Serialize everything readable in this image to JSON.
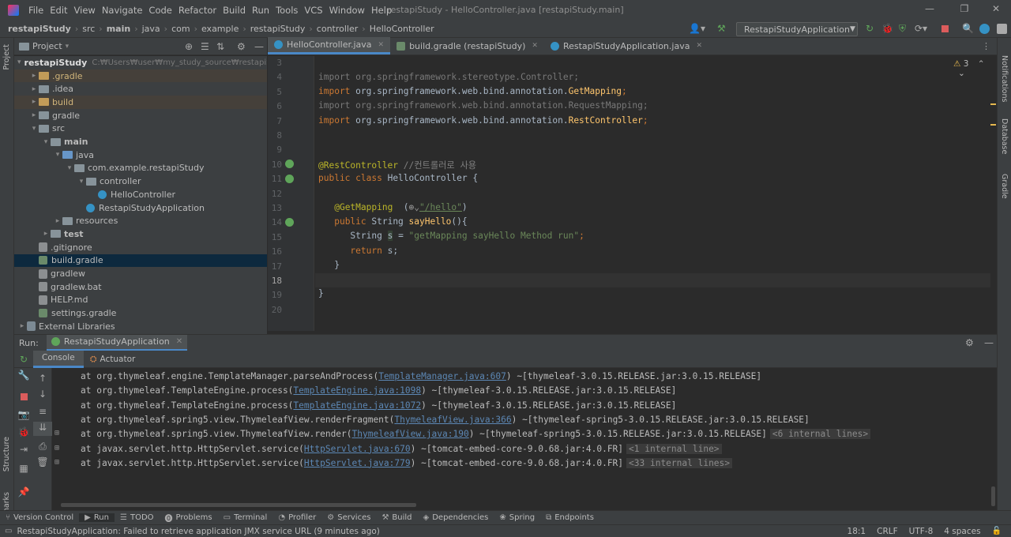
{
  "window": {
    "title": "restapiStudy - HelloController.java [restapiStudy.main]"
  },
  "menu": [
    "File",
    "Edit",
    "View",
    "Navigate",
    "Code",
    "Refactor",
    "Build",
    "Run",
    "Tools",
    "VCS",
    "Window",
    "Help"
  ],
  "breadcrumb": [
    "restapiStudy",
    "src",
    "main",
    "java",
    "com",
    "example",
    "restapiStudy",
    "controller",
    "HelloController"
  ],
  "toolbar": {
    "run_config": "RestapiStudyApplication"
  },
  "project_panel": {
    "title": "Project",
    "root_name": "restapiStudy",
    "root_path": "C:₩Users₩user₩my_study_source₩restapiStudy",
    "items": [
      {
        "label": ".gradle",
        "kind": "folder-orange",
        "depth": 1,
        "arrow": "▸"
      },
      {
        "label": ".idea",
        "kind": "folder",
        "depth": 1,
        "arrow": "▸"
      },
      {
        "label": "build",
        "kind": "folder-orange",
        "depth": 1,
        "arrow": "▸"
      },
      {
        "label": "gradle",
        "kind": "folder",
        "depth": 1,
        "arrow": "▸"
      },
      {
        "label": "src",
        "kind": "folder",
        "depth": 1,
        "arrow": "▾"
      },
      {
        "label": "main",
        "kind": "folder",
        "depth": 2,
        "arrow": "▾"
      },
      {
        "label": "java",
        "kind": "folder-blue",
        "depth": 3,
        "arrow": "▾"
      },
      {
        "label": "com.example.restapiStudy",
        "kind": "folder",
        "depth": 4,
        "arrow": "▾"
      },
      {
        "label": "controller",
        "kind": "folder",
        "depth": 5,
        "arrow": "▾"
      },
      {
        "label": "HelloController",
        "kind": "class",
        "depth": 6,
        "arrow": ""
      },
      {
        "label": "RestapiStudyApplication",
        "kind": "class",
        "depth": 5,
        "arrow": ""
      },
      {
        "label": "resources",
        "kind": "folder",
        "depth": 3,
        "arrow": "▸"
      },
      {
        "label": "test",
        "kind": "folder",
        "depth": 2,
        "arrow": "▸"
      },
      {
        "label": ".gitignore",
        "kind": "file",
        "depth": 1,
        "arrow": ""
      },
      {
        "label": "build.gradle",
        "kind": "gradle",
        "depth": 1,
        "arrow": ""
      },
      {
        "label": "gradlew",
        "kind": "file",
        "depth": 1,
        "arrow": ""
      },
      {
        "label": "gradlew.bat",
        "kind": "file",
        "depth": 1,
        "arrow": ""
      },
      {
        "label": "HELP.md",
        "kind": "file",
        "depth": 1,
        "arrow": ""
      },
      {
        "label": "settings.gradle",
        "kind": "gradle",
        "depth": 1,
        "arrow": ""
      },
      {
        "label": "External Libraries",
        "kind": "lib",
        "depth": 0,
        "arrow": "▸"
      }
    ]
  },
  "editor_tabs": [
    {
      "label": "HelloController.java",
      "icon": "class-icon",
      "active": true
    },
    {
      "label": "build.gradle (restapiStudy)",
      "icon": "gradle-icon",
      "active": false
    },
    {
      "label": "RestapiStudyApplication.java",
      "icon": "class-icon",
      "active": false
    }
  ],
  "inspection": {
    "warnings": "3"
  },
  "code": {
    "line_numbers": [
      "3",
      "4",
      "5",
      "6",
      "7",
      "8",
      "9",
      "10",
      "11",
      "12",
      "13",
      "14",
      "15",
      "16",
      "17",
      "18",
      "19",
      "20"
    ],
    "l4_import": "import",
    "l4_rest": " org.springframework.stereotype.Controller;",
    "l5_import": "import",
    "l5_pkg": " org.springframework.web.bind.annotation.",
    "l5_cls": "GetMapping",
    "l5_end": ";",
    "l6_import": "import",
    "l6_rest": " org.springframework.web.bind.annotation.RequestMapping;",
    "l7_import": "import",
    "l7_pkg": " org.springframework.web.bind.annotation.",
    "l7_cls": "RestController",
    "l7_end": ";",
    "l10_ann": "@RestController",
    "l10_cmt": " //컨트롤러로 사용",
    "l11_public": "public",
    "l11_class": " class",
    "l11_rest": " HelloController {",
    "l13_ann": "@GetMapping",
    "l13_mid": "  (",
    "l13_icon": "⊕⌄",
    "l13_str": "\"/hello\"",
    "l13_end": ")",
    "l14_public": "public",
    "l14_type": " String ",
    "l14_fn": "sayHello",
    "l14_end": "(){",
    "l15_a": "String ",
    "l15_var": "s",
    "l15_b": " = ",
    "l15_str": "\"getMapping sayHello Method run\"",
    "l15_end": ";",
    "l16_ret": "return",
    "l16_rest": " s;",
    "l17": "}",
    "l19": "}"
  },
  "run_panel": {
    "label": "Run:",
    "config": "RestapiStudyApplication",
    "tab_console": "Console",
    "tab_actuator": "Actuator",
    "lines": [
      {
        "pre": "at org.thymeleaf.engine.TemplateManager.parseAndProcess(",
        "link": "TemplateManager.java:607",
        "post": ") ~[thymeleaf-3.0.15.RELEASE.jar:3.0.15.RELEASE]",
        "fold": ""
      },
      {
        "pre": "at org.thymeleaf.TemplateEngine.process(",
        "link": "TemplateEngine.java:1098",
        "post": ") ~[thymeleaf-3.0.15.RELEASE.jar:3.0.15.RELEASE]",
        "fold": ""
      },
      {
        "pre": "at org.thymeleaf.TemplateEngine.process(",
        "link": "TemplateEngine.java:1072",
        "post": ") ~[thymeleaf-3.0.15.RELEASE.jar:3.0.15.RELEASE]",
        "fold": ""
      },
      {
        "pre": "at org.thymeleaf.spring5.view.ThymeleafView.renderFragment(",
        "link": "ThymeleafView.java:366",
        "post": ") ~[thymeleaf-spring5-3.0.15.RELEASE.jar:3.0.15.RELEASE]",
        "fold": ""
      },
      {
        "pre": "at org.thymeleaf.spring5.view.ThymeleafView.render(",
        "link": "ThymeleafView.java:190",
        "post": ") ~[thymeleaf-spring5-3.0.15.RELEASE.jar:3.0.15.RELEASE]",
        "fold": "<6 internal lines>"
      },
      {
        "pre": "at javax.servlet.http.HttpServlet.service(",
        "link": "HttpServlet.java:670",
        "post": ") ~[tomcat-embed-core-9.0.68.jar:4.0.FR]",
        "fold": "<1 internal line>"
      },
      {
        "pre": "at javax.servlet.http.HttpServlet.service(",
        "link": "HttpServlet.java:779",
        "post": ") ~[tomcat-embed-core-9.0.68.jar:4.0.FR]",
        "fold": "<33 internal lines>"
      }
    ]
  },
  "bottom_tabs": [
    "Version Control",
    "Run",
    "TODO",
    "Problems",
    "Terminal",
    "Profiler",
    "Services",
    "Build",
    "Dependencies",
    "Spring",
    "Endpoints"
  ],
  "side_labels": {
    "project": "Project",
    "structure": "Structure",
    "bookmarks": "Bookmarks",
    "notifications": "Notifications",
    "database": "Database",
    "gradle": "Gradle"
  },
  "status": {
    "message": "RestapiStudyApplication: Failed to retrieve application JMX service URL (9 minutes ago)",
    "position": "18:1",
    "line_sep": "CRLF",
    "encoding": "UTF-8",
    "indent": "4 spaces"
  }
}
